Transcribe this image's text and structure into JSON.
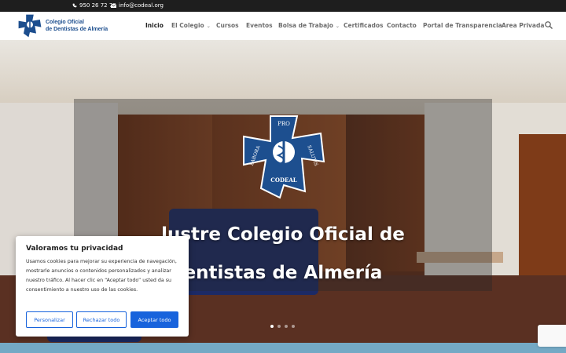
{
  "topbar": {
    "phone": "950 26 72 78",
    "email": "info@codeal.org"
  },
  "header": {
    "logo_line1": "Colegio Oficial",
    "logo_line2": "de Dentistas de Almería",
    "nav": [
      {
        "label": "Inicio",
        "active": true,
        "dropdown": false
      },
      {
        "label": "El Colegio",
        "active": false,
        "dropdown": true
      },
      {
        "label": "Cursos",
        "active": false,
        "dropdown": false
      },
      {
        "label": "Eventos",
        "active": false,
        "dropdown": false
      },
      {
        "label": "Bolsa de Trabajo",
        "active": false,
        "dropdown": true
      },
      {
        "label": "Certificados",
        "active": false,
        "dropdown": false
      },
      {
        "label": "Contacto",
        "active": false,
        "dropdown": false
      },
      {
        "label": "Portal de Transparencia",
        "active": false,
        "dropdown": false
      },
      {
        "label": "Area Privada",
        "active": false,
        "dropdown": false
      }
    ],
    "search_icon": "search-icon"
  },
  "hero": {
    "emblem_text": {
      "top": "PRO",
      "left": "LABORA",
      "right": "SALUTIS",
      "bottom": "CODEAL"
    },
    "title_line1": "lustre Colegio Oficial de",
    "title_line2": "entistas de Almería",
    "slides": 4,
    "active_slide": 1
  },
  "cookie": {
    "title": "Valoramos tu privacidad",
    "body": "Usamos cookies para mejorar su experiencia de navegación, mostrarle anuncios o contenidos personalizados y analizar nuestro tráfico. Al hacer clic en “Aceptar todo” usted da su consentimiento a nuestro uso de las cookies.",
    "btn_customize": "Personalizar",
    "btn_reject": "Rechazar todo",
    "btn_accept": "Aceptar todo"
  },
  "colors": {
    "brand": "#1c4e8e",
    "accent": "#1863dc",
    "topbar": "#1e1e1e"
  }
}
